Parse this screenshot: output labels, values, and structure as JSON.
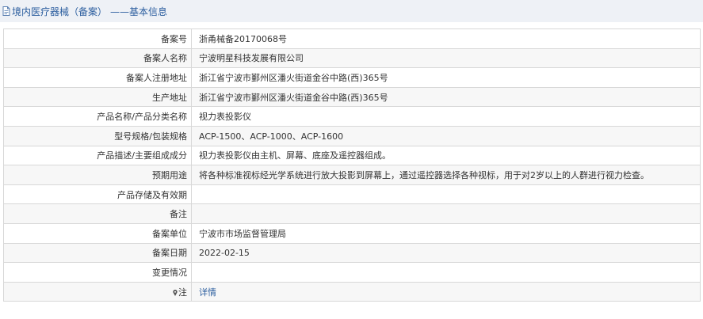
{
  "header": {
    "title": "境内医疗器械（备案）",
    "subtitle": "——基本信息",
    "icon": "document-icon"
  },
  "rows": [
    {
      "label": "备案号",
      "value": "浙甬械备20170068号"
    },
    {
      "label": "备案人名称",
      "value": "宁波明星科技发展有限公司"
    },
    {
      "label": "备案人注册地址",
      "value": "浙江省宁波市鄞州区潘火街道金谷中路(西)365号"
    },
    {
      "label": "生产地址",
      "value": "浙江省宁波市鄞州区潘火街道金谷中路(西)365号"
    },
    {
      "label": "产品名称/产品分类名称",
      "value": "视力表投影仪"
    },
    {
      "label": "型号规格/包装规格",
      "value": "ACP-1500、ACP-1000、ACP-1600"
    },
    {
      "label": "产品描述/主要组成成分",
      "value": "视力表投影仪由主机、屏幕、底座及遥控器组成。"
    },
    {
      "label": "预期用途",
      "value": "将各种标准视标经光学系统进行放大投影到屏幕上，通过遥控器选择各种视标，用于对2岁以上的人群进行视力检查。"
    },
    {
      "label": "产品存储及有效期",
      "value": ""
    },
    {
      "label": "备注",
      "value": ""
    },
    {
      "label": "备案单位",
      "value": "宁波市市场监督管理局"
    },
    {
      "label": "备案日期",
      "value": "2022-02-15"
    },
    {
      "label": "变更情况",
      "value": ""
    }
  ],
  "note_row": {
    "label": "注",
    "icon": "pin-icon",
    "link_text": "详情"
  },
  "colors": {
    "header_bg": "#eef1f6",
    "link": "#2a5d9e",
    "border": "#d8d8d8"
  }
}
